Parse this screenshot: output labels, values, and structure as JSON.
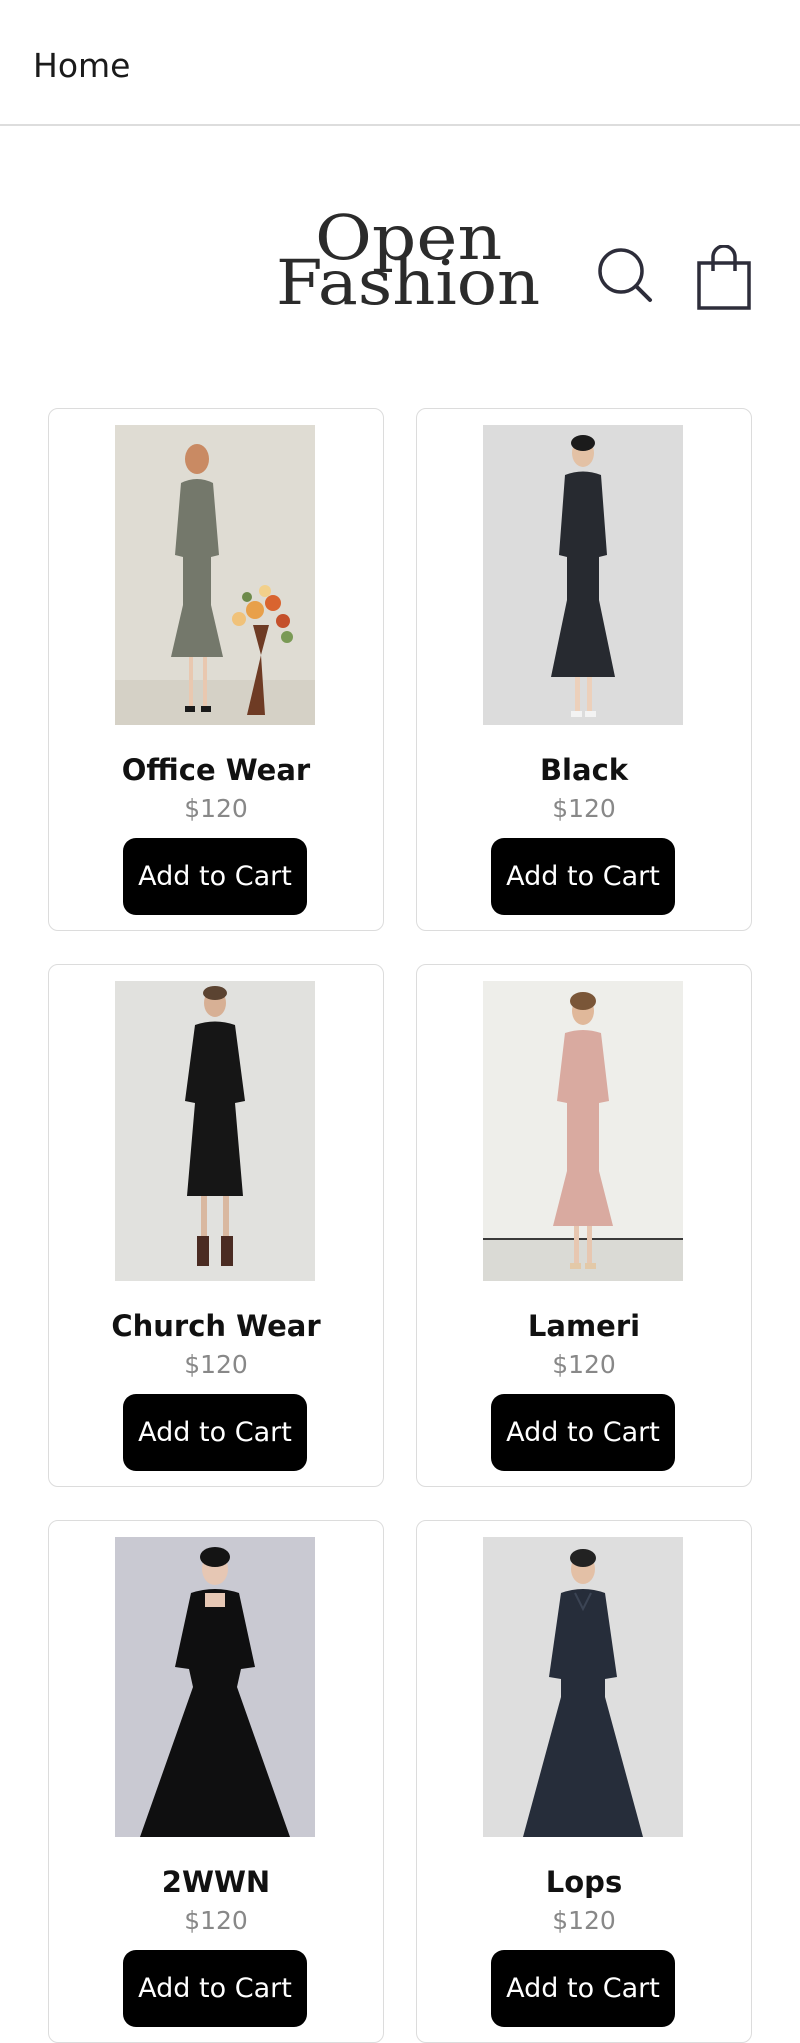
{
  "nav": {
    "home_label": "Home"
  },
  "header": {
    "brand_line1": "Open",
    "brand_line2": "Fashion"
  },
  "products": [
    {
      "name": "Office Wear",
      "price": "$120",
      "button": "Add to Cart"
    },
    {
      "name": "Black",
      "price": "$120",
      "button": "Add to Cart"
    },
    {
      "name": "Church Wear",
      "price": "$120",
      "button": "Add to Cart"
    },
    {
      "name": "Lameri",
      "price": "$120",
      "button": "Add to Cart"
    },
    {
      "name": "2WWN",
      "price": "$120",
      "button": "Add to Cart"
    },
    {
      "name": "Lops",
      "price": "$120",
      "button": "Add to Cart"
    }
  ],
  "icons": {
    "search": "search-icon",
    "cart": "shopping-bag-icon"
  },
  "colors": {
    "button_bg": "#000000",
    "button_text": "#ffffff",
    "price_text": "#888888",
    "card_border": "#dcdcdc"
  }
}
